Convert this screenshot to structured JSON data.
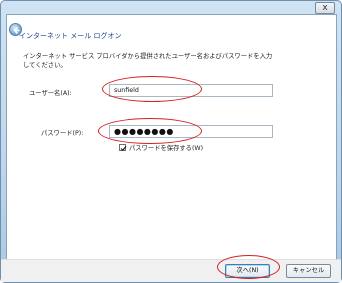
{
  "window": {
    "close_glyph": "x"
  },
  "dialog": {
    "heading": "インターネット メール ログオン",
    "description_lines": [
      "インターネット サービス プロバイダから提供されたユーザー名およびパスワードを入力",
      "してください。"
    ],
    "username_label": "ユーザー名(A):",
    "username_value": "sunfield",
    "password_label": "パスワード(P):",
    "password_value": "●●●●●●●●",
    "remember_label": "パスワードを保存する(W)",
    "remember_checked": true
  },
  "footer": {
    "next_label": "次へ(N)",
    "cancel_label": "キャンセル"
  },
  "colors": {
    "annotation": "#d42020",
    "heading": "#1f3f8f"
  }
}
